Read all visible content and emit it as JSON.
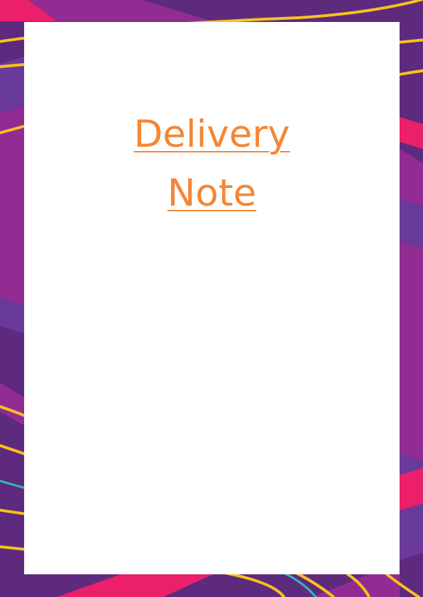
{
  "document": {
    "title_lines": [
      "Delivery",
      "Note"
    ]
  },
  "colors": {
    "frame_base": "#5e2a7e",
    "frame_magenta": "#912c93",
    "frame_violet": "#6a3a9a",
    "frame_pink": "#ec1f6a",
    "frame_yellow": "#f7c21b",
    "frame_teal": "#35b8b3",
    "title": "#f58634"
  }
}
